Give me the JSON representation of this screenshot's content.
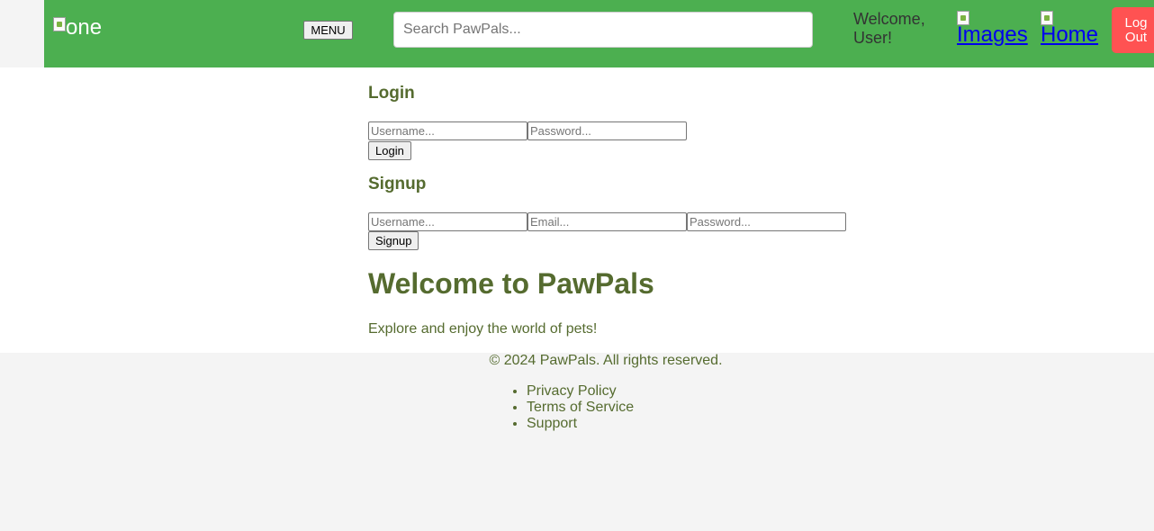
{
  "header": {
    "logo_alt": "one",
    "menu_label": "MENU",
    "search_placeholder": "Search PawPals...",
    "welcome_text": "Welcome, User!",
    "nav": {
      "images_label": "Images",
      "home_label": "Home"
    },
    "logout_label": "Log Out"
  },
  "login": {
    "title": "Login",
    "username_placeholder": "Username...",
    "password_placeholder": "Password...",
    "button_label": "Login"
  },
  "signup": {
    "title": "Signup",
    "username_placeholder": "Username...",
    "email_placeholder": "Email...",
    "password_placeholder": "Password...",
    "button_label": "Signup"
  },
  "hero": {
    "title": "Welcome to PawPals",
    "text": "Explore and enjoy the world of pets!"
  },
  "footer": {
    "copyright": "© 2024 PawPals. All rights reserved.",
    "links": [
      "Privacy Policy",
      "Terms of Service",
      "Support"
    ]
  },
  "colors": {
    "header_bg": "#4caf50",
    "logout_bg": "#ff5252",
    "text_olive": "#556b2f",
    "link_blue": "#0000ee"
  }
}
